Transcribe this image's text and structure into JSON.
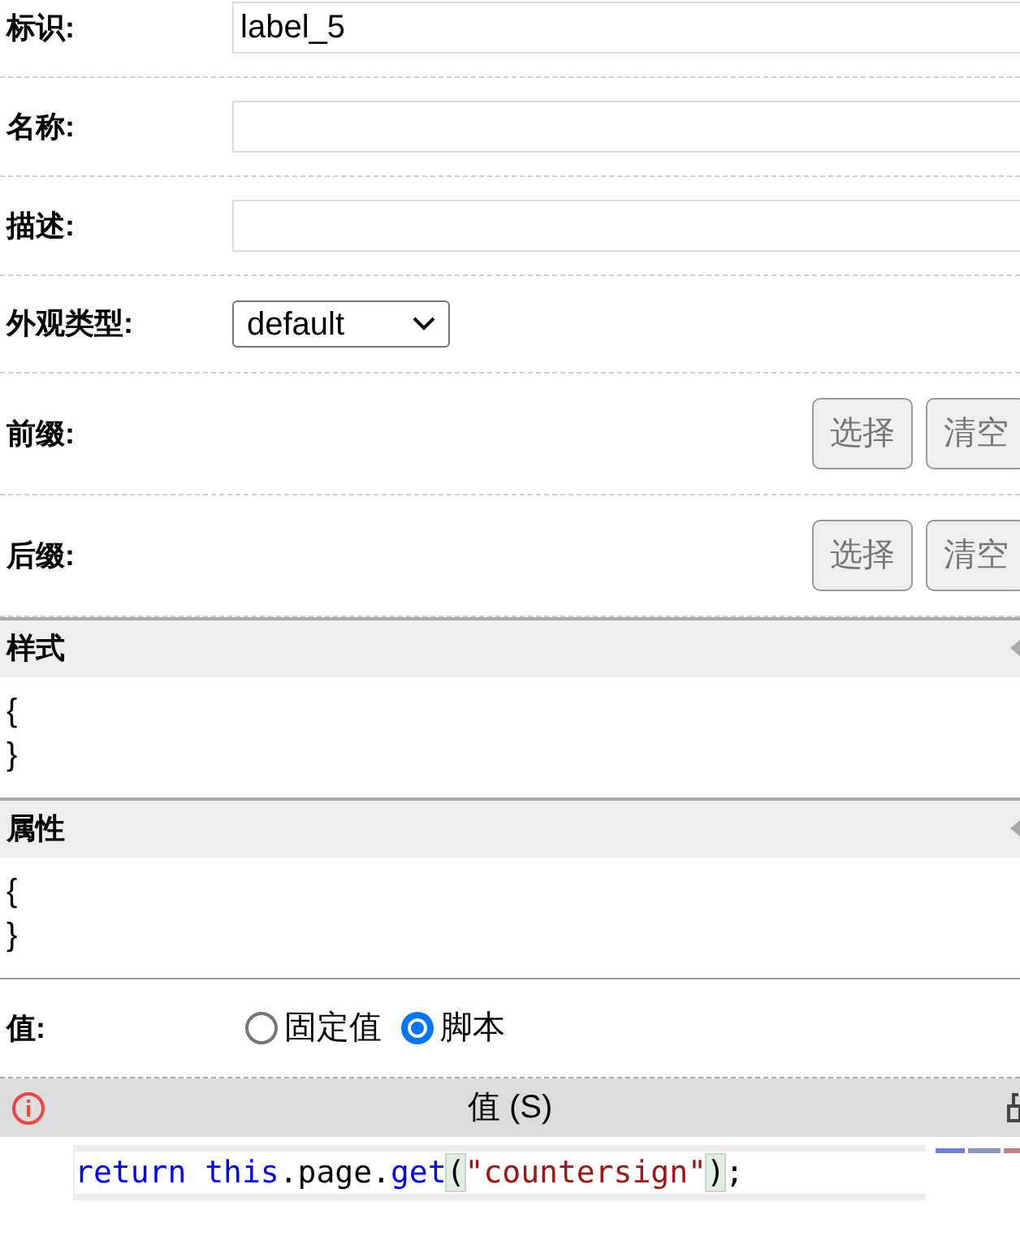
{
  "fields": [
    {
      "kind": "text",
      "label": "标识:",
      "value": "label_5"
    },
    {
      "kind": "text",
      "label": "名称:"
    },
    {
      "kind": "text",
      "label": "描述:"
    },
    {
      "kind": "select",
      "label": "外观类型:",
      "value": "default"
    },
    {
      "kind": "picker",
      "label": "前缀:",
      "buttons": [
        "选择",
        "清空"
      ]
    },
    {
      "kind": "picker",
      "label": "后缀:",
      "buttons": [
        "选择",
        "清空"
      ]
    }
  ],
  "sections": [
    {
      "title": "样式",
      "lines": [
        "{",
        "}"
      ]
    },
    {
      "title": "属性",
      "lines": [
        "{",
        "}"
      ]
    }
  ],
  "value": {
    "label": "值:",
    "options": [
      {
        "label": "固定值",
        "selected": false
      },
      {
        "label": "脚本",
        "selected": true
      }
    ]
  },
  "script_panel": {
    "title": "值 (S)",
    "code": [
      {
        "kind": "keyword",
        "text": "return this"
      },
      {
        "kind": "plain",
        "text": ".page."
      },
      {
        "kind": "keyword",
        "text": "get"
      },
      {
        "kind": "bracket",
        "text": "("
      },
      {
        "kind": "string",
        "text": "\"countersign\""
      },
      {
        "kind": "bracket",
        "text": ")"
      },
      {
        "kind": "plain",
        "text": ";"
      }
    ]
  }
}
